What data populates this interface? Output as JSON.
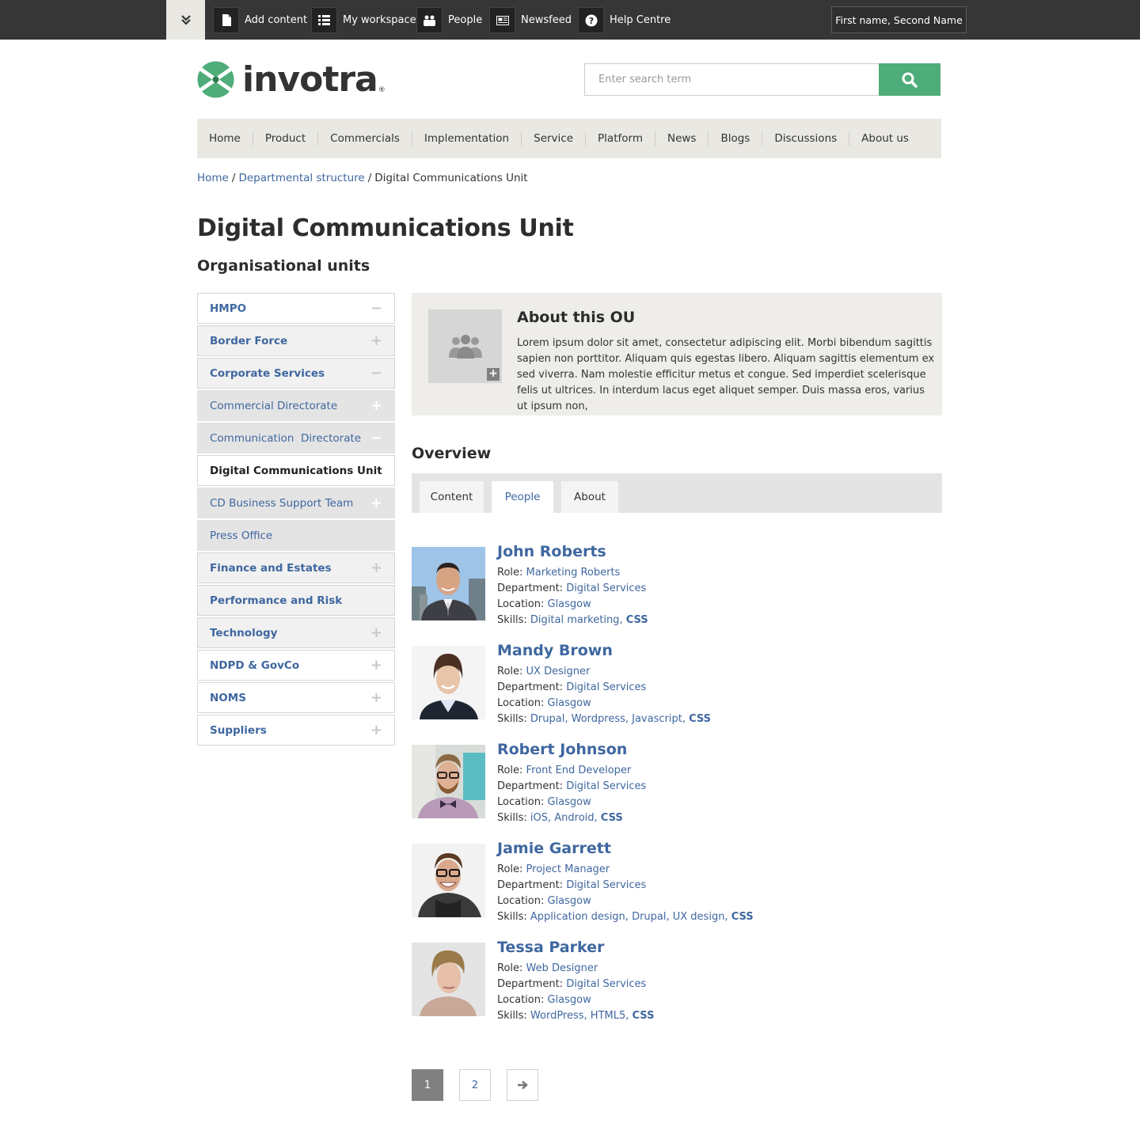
{
  "topbar": {
    "items": [
      {
        "label": "Add content",
        "icon": "document-icon"
      },
      {
        "label": "My workspace",
        "icon": "list-icon"
      },
      {
        "label": "People",
        "icon": "people-icon"
      },
      {
        "label": "Newsfeed",
        "icon": "newspaper-icon"
      },
      {
        "label": "Help Centre",
        "icon": "help-icon"
      }
    ],
    "user": "First name, Second Name"
  },
  "header": {
    "logo_text": "invotra",
    "logo_reg": "®",
    "search_placeholder": "Enter search term",
    "brand_color": "#4ead7a"
  },
  "nav": [
    "Home",
    "Product",
    "Commercials",
    "Implementation",
    "Service",
    "Platform",
    "News",
    "Blogs",
    "Discussions",
    "About us"
  ],
  "breadcrumb": {
    "home": "Home",
    "sep": "/",
    "parent": "Departmental structure",
    "current": "Digital Communications Unit"
  },
  "page_title": "Digital Communications Unit",
  "sidebar": {
    "title": "Organisational units",
    "items": [
      {
        "label": "HMPO",
        "sign": "−"
      },
      {
        "label": "Border Force",
        "sign": "+"
      },
      {
        "label": "Corporate Services",
        "sign": "−"
      },
      {
        "label": "Commercial Directorate",
        "sign": "+"
      },
      {
        "label": "Communication  Directorate",
        "sign": "−"
      },
      {
        "label": "Digital Communications Unit",
        "sign": ""
      },
      {
        "label": "CD Business Support Team",
        "sign": "+"
      },
      {
        "label": "Press Office",
        "sign": ""
      },
      {
        "label": "Finance and Estates",
        "sign": "+"
      },
      {
        "label": "Performance and Risk",
        "sign": ""
      },
      {
        "label": "Technology",
        "sign": "+"
      },
      {
        "label": "NDPD & GovCo",
        "sign": "+"
      },
      {
        "label": "NOMS",
        "sign": "+"
      },
      {
        "label": "Suppliers",
        "sign": "+"
      }
    ]
  },
  "about": {
    "title": "About this OU",
    "text": "Lorem ipsum dolor sit amet, consectetur adipiscing elit. Morbi bibendum sagittis sapien non porttitor. Aliquam quis egestas libero. Aliquam sagittis elementum ex sed viverra. Nam molestie efficitur metus et congue. Sed imperdiet scelerisque felis ut ultrices. In interdum lacus eget aliquet semper. Duis massa eros, varius ut ipsum non,"
  },
  "overview": {
    "title": "Overview",
    "tabs": [
      "Content",
      "People",
      "About"
    ],
    "active_tab": "People"
  },
  "labels": {
    "role": "Role: ",
    "department": "Department: ",
    "location": "Location: ",
    "skills": "Skills: "
  },
  "people": [
    {
      "name": "John Roberts",
      "role": "Marketing Roberts",
      "department": "Digital Services",
      "location": "Glasgow",
      "skills": "Digital marketing, ",
      "skill_bold": "CSS"
    },
    {
      "name": "Mandy Brown",
      "role": "UX Designer",
      "department": "Digital Services",
      "location": "Glasgow",
      "skills": "Drupal, Wordpress, Javascript, ",
      "skill_bold": "CSS"
    },
    {
      "name": "Robert Johnson",
      "role": "Front End Developer",
      "department": "Digital Services",
      "location": "Glasgow",
      "skills": "iOS, Android, ",
      "skill_bold": "CSS"
    },
    {
      "name": "Jamie Garrett",
      "role": "Project Manager",
      "department": "Digital Services",
      "location": "Glasgow",
      "skills": "Application design, Drupal, UX design, ",
      "skill_bold": "CSS"
    },
    {
      "name": "Tessa Parker",
      "role": "Web Designer",
      "department": "Digital Services",
      "location": "Glasgow",
      "skills": "WordPress, HTML5, ",
      "skill_bold": "CSS"
    }
  ],
  "pager": {
    "pages": [
      "1",
      "2"
    ],
    "current": "1"
  }
}
